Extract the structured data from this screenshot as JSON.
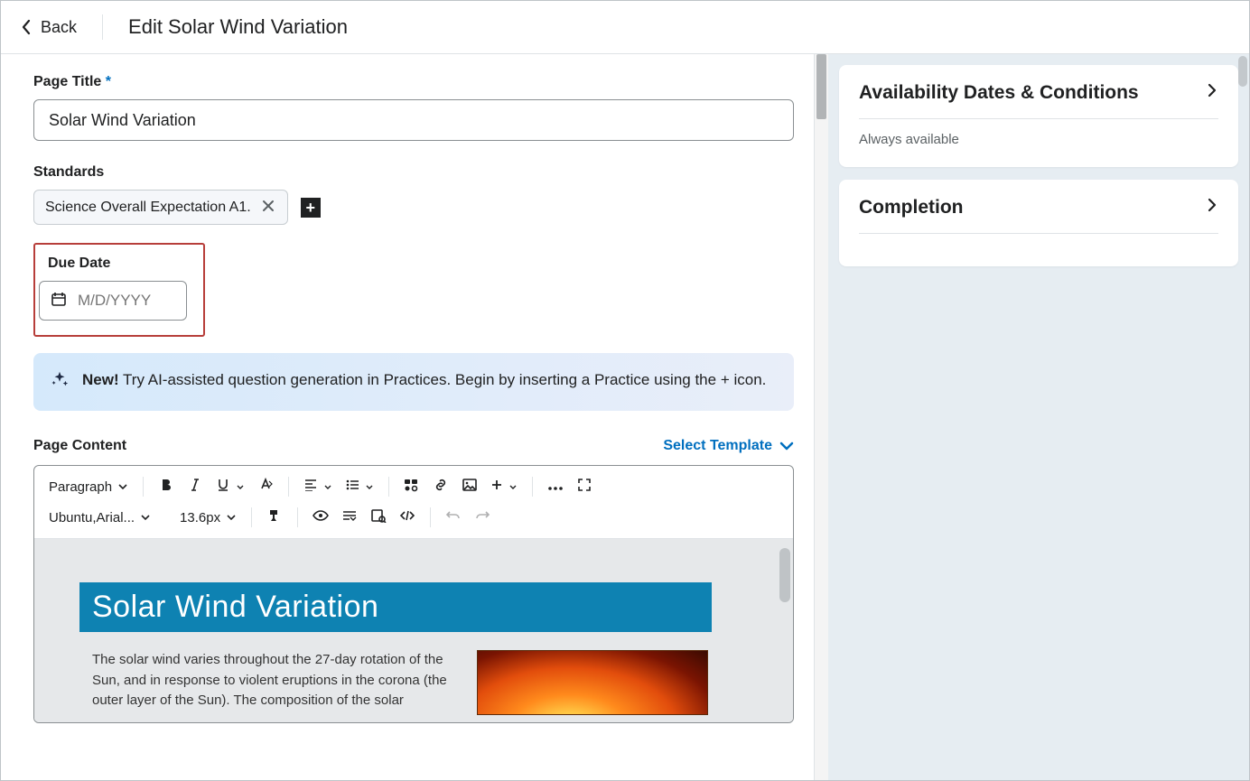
{
  "header": {
    "back_label": "Back",
    "title": "Edit Solar Wind Variation"
  },
  "form": {
    "page_title_label": "Page Title",
    "required_mark": "*",
    "page_title_value": "Solar Wind Variation",
    "standards_label": "Standards",
    "standards_chip": "Science Overall Expectation A1.",
    "due_date_label": "Due Date",
    "due_date_placeholder": "M/D/YYYY",
    "ai_banner_bold": "New!",
    "ai_banner_text": " Try AI-assisted question generation in Practices. Begin by inserting a Practice using the + icon.",
    "content_label": "Page Content",
    "select_template": "Select Template"
  },
  "toolbar": {
    "block": "Paragraph",
    "font": "Ubuntu,Arial...",
    "size": "13.6px"
  },
  "doc": {
    "title": "Solar Wind Variation",
    "paragraph": "The solar wind varies throughout the 27-day rotation of the Sun, and in response to violent eruptions in the corona (the outer layer of the Sun). The composition of the solar"
  },
  "side": {
    "availability_title": "Availability Dates & Conditions",
    "availability_status": "Always available",
    "completion_title": "Completion"
  }
}
